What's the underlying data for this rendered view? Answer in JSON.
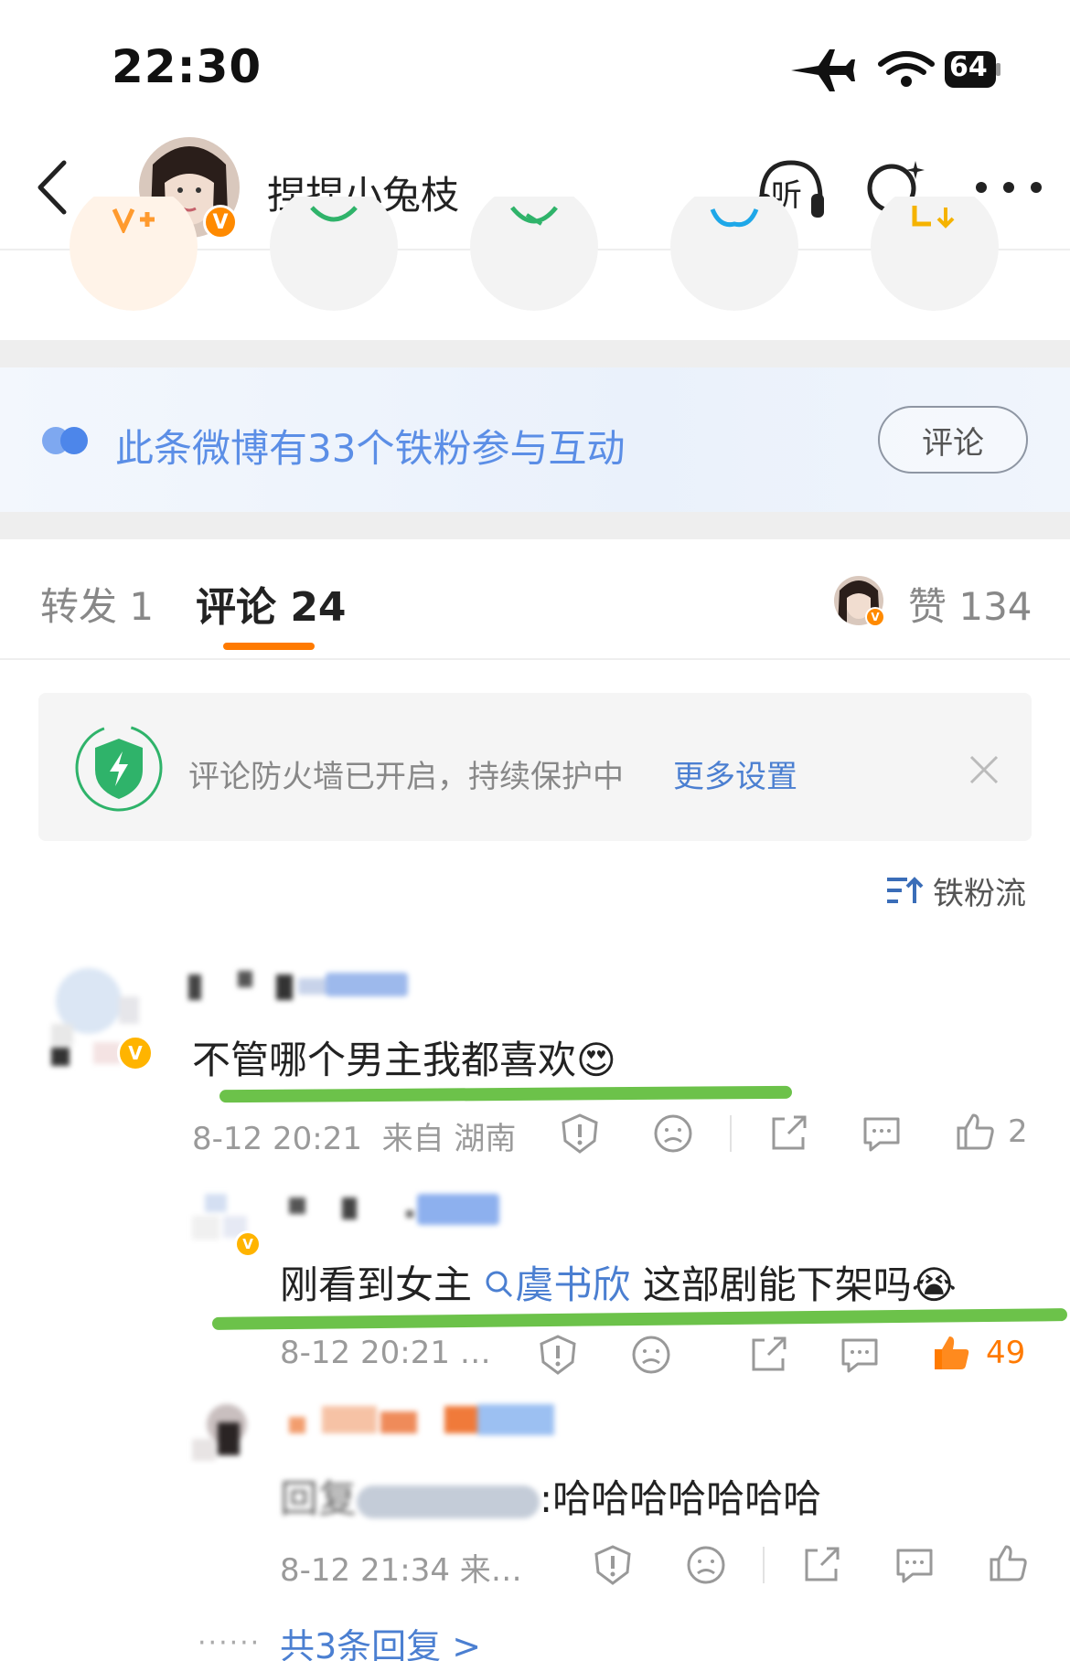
{
  "status_bar": {
    "time": "22:30",
    "battery": "64"
  },
  "header": {
    "user_name": "捏捏小兔枝",
    "listen_label": "听",
    "v_badge": "V"
  },
  "fans_banner": {
    "text": "此条微博有33个铁粉参与互动",
    "button_label": "评论"
  },
  "tabs": {
    "repost": "转发 1",
    "comment": "评论 24",
    "likes": "赞 134"
  },
  "firewall": {
    "text": "评论防火墙已开启，持续保护中",
    "link": "更多设置"
  },
  "sort": {
    "label": "铁粉流"
  },
  "comments": [
    {
      "text": "不管哪个男主我都喜欢",
      "emoji": "😍",
      "time": "8-12 20:21",
      "location": "来自 湖南",
      "likes": "2"
    },
    {
      "text_before": "刚看到女主",
      "mention": "虞书欣",
      "text_after": "这部剧能下架吗",
      "emoji": "😭",
      "time": "8-12 20:21 …",
      "likes": "49"
    },
    {
      "text_prefix": "回复",
      "text": ":哈哈哈哈哈哈哈",
      "time": "8-12 21:34 来…",
      "likes": ""
    }
  ],
  "replies_link": "共3条回复 >",
  "colors": {
    "accent_orange": "#ff7a00",
    "link_blue": "#4b7fd1",
    "highlight_green": "#6cc24a",
    "firewall_green": "#2fb36a"
  }
}
